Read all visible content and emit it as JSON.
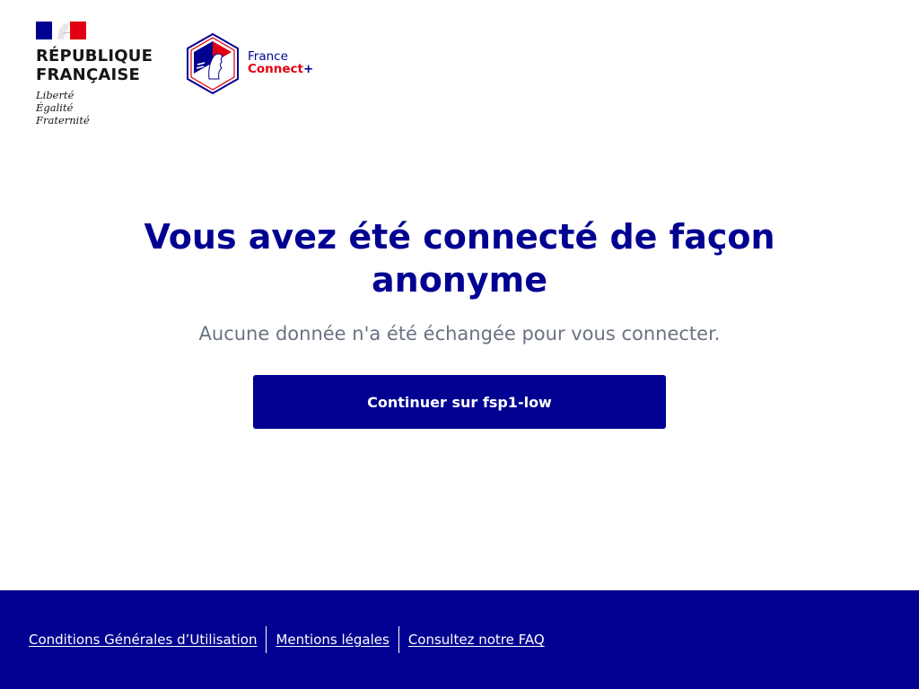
{
  "header": {
    "republic_line1": "RÉPUBLIQUE",
    "republic_line2": "FRANÇAISE",
    "motto_liberte": "Liberté",
    "motto_egalite": "Égalité",
    "motto_fraternite": "Fraternité",
    "franceconnect_word1": "France",
    "franceconnect_word2": "Connect",
    "franceconnect_plus": "+"
  },
  "main": {
    "title": "Vous avez été connecté de façon anonyme",
    "subtitle": "Aucune donnée n'a été échangée pour vous connecter.",
    "continue_label": "Continuer sur fsp1-low"
  },
  "footer": {
    "links": [
      "Conditions Générales d’Utilisation",
      "Mentions légales",
      "Consultez notre FAQ"
    ]
  },
  "colors": {
    "brand_blue": "#000091",
    "brand_red": "#e1000f",
    "subtitle_gray": "#6a7282"
  },
  "icons": {
    "marianne": "marianne-flag-icon",
    "franceconnect": "franceconnect-hexagon-logo"
  }
}
